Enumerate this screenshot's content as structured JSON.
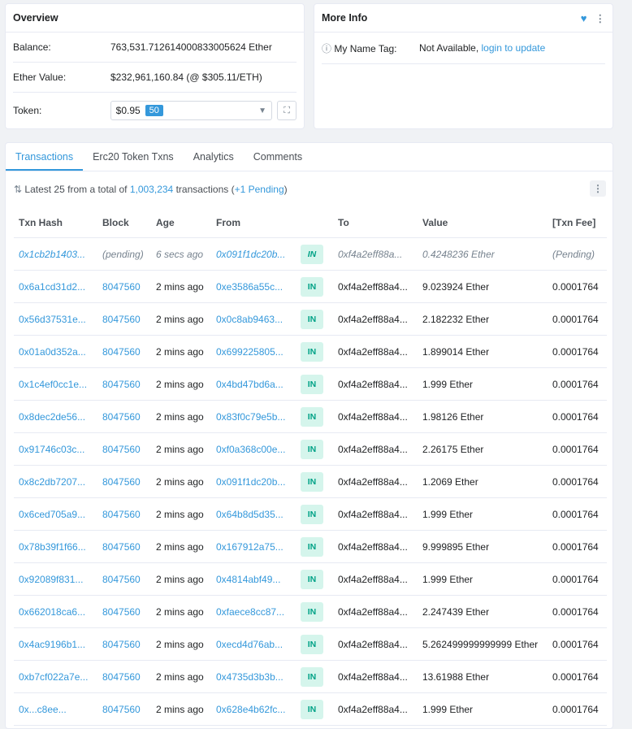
{
  "overview": {
    "title": "Overview",
    "balance_label": "Balance:",
    "balance_value": "763,531.712614000833005624 Ether",
    "ether_value_label": "Ether Value:",
    "ether_value": "$232,961,160.84 (@ $305.11/ETH)",
    "token_label": "Token:",
    "token_value": "$0.95",
    "token_count": "50"
  },
  "more_info": {
    "title": "More Info",
    "name_tag_label": "My Name Tag:",
    "name_tag_value": "Not Available,",
    "name_tag_link": "login to update"
  },
  "tabs": [
    "Transactions",
    "Erc20 Token Txns",
    "Analytics",
    "Comments"
  ],
  "summary": {
    "prefix": "Latest 25 from a total of",
    "total": "1,003,234",
    "suffix": "transactions (",
    "pending": "+1 Pending",
    "close": ")"
  },
  "table": {
    "headers": [
      "Txn Hash",
      "Block",
      "Age",
      "From",
      "",
      "To",
      "Value",
      "[Txn Fee]"
    ],
    "rows": [
      {
        "hash": "0x1cb2b1403...",
        "block": "(pending)",
        "age": "6 secs ago",
        "from": "0x091f1dc20b...",
        "dir": "IN",
        "to": "0xf4a2eff88a...",
        "value": "0.4248236 Ether",
        "fee": "(Pending)",
        "pending": true
      },
      {
        "hash": "0x6a1cd31d2...",
        "block": "8047560",
        "age": "2 mins ago",
        "from": "0xe3586a55c...",
        "dir": "IN",
        "to": "0xf4a2eff88a4...",
        "value": "9.023924 Ether",
        "fee": "0.0001764"
      },
      {
        "hash": "0x56d37531e...",
        "block": "8047560",
        "age": "2 mins ago",
        "from": "0x0c8ab9463...",
        "dir": "IN",
        "to": "0xf4a2eff88a4...",
        "value": "2.182232 Ether",
        "fee": "0.0001764"
      },
      {
        "hash": "0x01a0d352a...",
        "block": "8047560",
        "age": "2 mins ago",
        "from": "0x699225805...",
        "dir": "IN",
        "to": "0xf4a2eff88a4...",
        "value": "1.899014 Ether",
        "fee": "0.0001764"
      },
      {
        "hash": "0x1c4ef0cc1e...",
        "block": "8047560",
        "age": "2 mins ago",
        "from": "0x4bd47bd6a...",
        "dir": "IN",
        "to": "0xf4a2eff88a4...",
        "value": "1.999 Ether",
        "fee": "0.0001764"
      },
      {
        "hash": "0x8dec2de56...",
        "block": "8047560",
        "age": "2 mins ago",
        "from": "0x83f0c79e5b...",
        "dir": "IN",
        "to": "0xf4a2eff88a4...",
        "value": "1.98126 Ether",
        "fee": "0.0001764"
      },
      {
        "hash": "0x91746c03c...",
        "block": "8047560",
        "age": "2 mins ago",
        "from": "0xf0a368c00e...",
        "dir": "IN",
        "to": "0xf4a2eff88a4...",
        "value": "2.26175 Ether",
        "fee": "0.0001764"
      },
      {
        "hash": "0x8c2db7207...",
        "block": "8047560",
        "age": "2 mins ago",
        "from": "0x091f1dc20b...",
        "dir": "IN",
        "to": "0xf4a2eff88a4...",
        "value": "1.2069 Ether",
        "fee": "0.0001764"
      },
      {
        "hash": "0x6ced705a9...",
        "block": "8047560",
        "age": "2 mins ago",
        "from": "0x64b8d5d35...",
        "dir": "IN",
        "to": "0xf4a2eff88a4...",
        "value": "1.999 Ether",
        "fee": "0.0001764"
      },
      {
        "hash": "0x78b39f1f66...",
        "block": "8047560",
        "age": "2 mins ago",
        "from": "0x167912a75...",
        "dir": "IN",
        "to": "0xf4a2eff88a4...",
        "value": "9.999895 Ether",
        "fee": "0.0001764"
      },
      {
        "hash": "0x92089f831...",
        "block": "8047560",
        "age": "2 mins ago",
        "from": "0x4814abf49...",
        "dir": "IN",
        "to": "0xf4a2eff88a4...",
        "value": "1.999 Ether",
        "fee": "0.0001764"
      },
      {
        "hash": "0x662018ca6...",
        "block": "8047560",
        "age": "2 mins ago",
        "from": "0xfaece8cc87...",
        "dir": "IN",
        "to": "0xf4a2eff88a4...",
        "value": "2.247439 Ether",
        "fee": "0.0001764"
      },
      {
        "hash": "0x4ac9196b1...",
        "block": "8047560",
        "age": "2 mins ago",
        "from": "0xecd4d76ab...",
        "dir": "IN",
        "to": "0xf4a2eff88a4...",
        "value": "5.262499999999999 Ether",
        "fee": "0.0001764"
      },
      {
        "hash": "0xb7cf022a7e...",
        "block": "8047560",
        "age": "2 mins ago",
        "from": "0x4735d3b3b...",
        "dir": "IN",
        "to": "0xf4a2eff88a4...",
        "value": "13.61988 Ether",
        "fee": "0.0001764"
      },
      {
        "hash": "0x...c8ee...",
        "block": "8047560",
        "age": "2 mins ago",
        "from": "0x628e4b62fc...",
        "dir": "IN",
        "to": "0xf4a2eff88a4...",
        "value": "1.999 Ether",
        "fee": "0.0001764"
      }
    ]
  }
}
